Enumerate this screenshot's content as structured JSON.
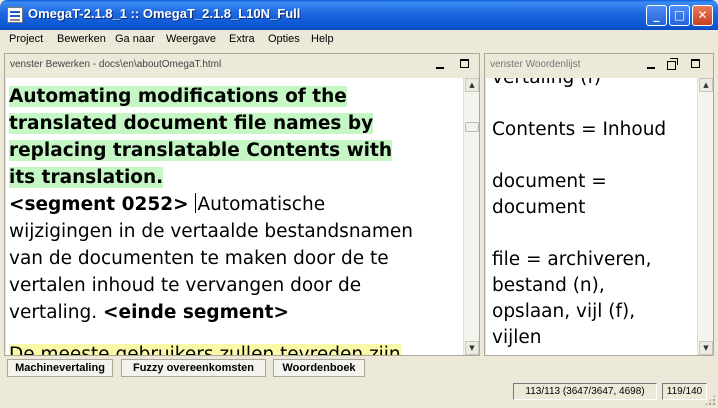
{
  "window": {
    "title": "OmegaT-2.1.8_1 :: OmegaT_2.1.8_L10N_Full"
  },
  "menu": {
    "items": [
      "Project",
      "Bewerken",
      "Ga naar",
      "Weergave",
      "Extra",
      "Opties",
      "Help"
    ]
  },
  "editor": {
    "caption": "venster Bewerken - docs\\en\\aboutOmegaT.html",
    "source_lines": [
      "Automating modifications of the",
      "translated document file names by",
      "replacing translatable Contents with",
      "its translation."
    ],
    "segment_start": "<segment 0252>",
    "target_first": "Automatische",
    "target_lines": [
      "wijzigingen in de vertaalde bestandsnamen",
      "van de documenten te maken door de te",
      "vertalen inhoud te vervangen door de"
    ],
    "target_last": "vertaling.",
    "segment_end": "<einde segment>",
    "next_source_partial": "De meeste gebruikers zullen tevreden zijn"
  },
  "glossary": {
    "caption": "venster Woordenlijst",
    "lines": [
      "vertaling (f)",
      "",
      "Contents = Inhoud",
      "",
      "document =",
      "document",
      "",
      "file = archiveren,",
      "bestand (n),",
      "opslaan, vijl (f),",
      "vijlen"
    ]
  },
  "tabs": [
    "Machinevertaling",
    "Fuzzy overeenkomsten",
    "Woordenboek"
  ],
  "status": {
    "progress": "113/113 (3647/3647, 4698)",
    "segment_counter": "119/140"
  },
  "colors": {
    "source_highlight": "#c4f7c4",
    "next_segment_highlight": "#faf9a8",
    "titlebar": "#0b55d0"
  }
}
